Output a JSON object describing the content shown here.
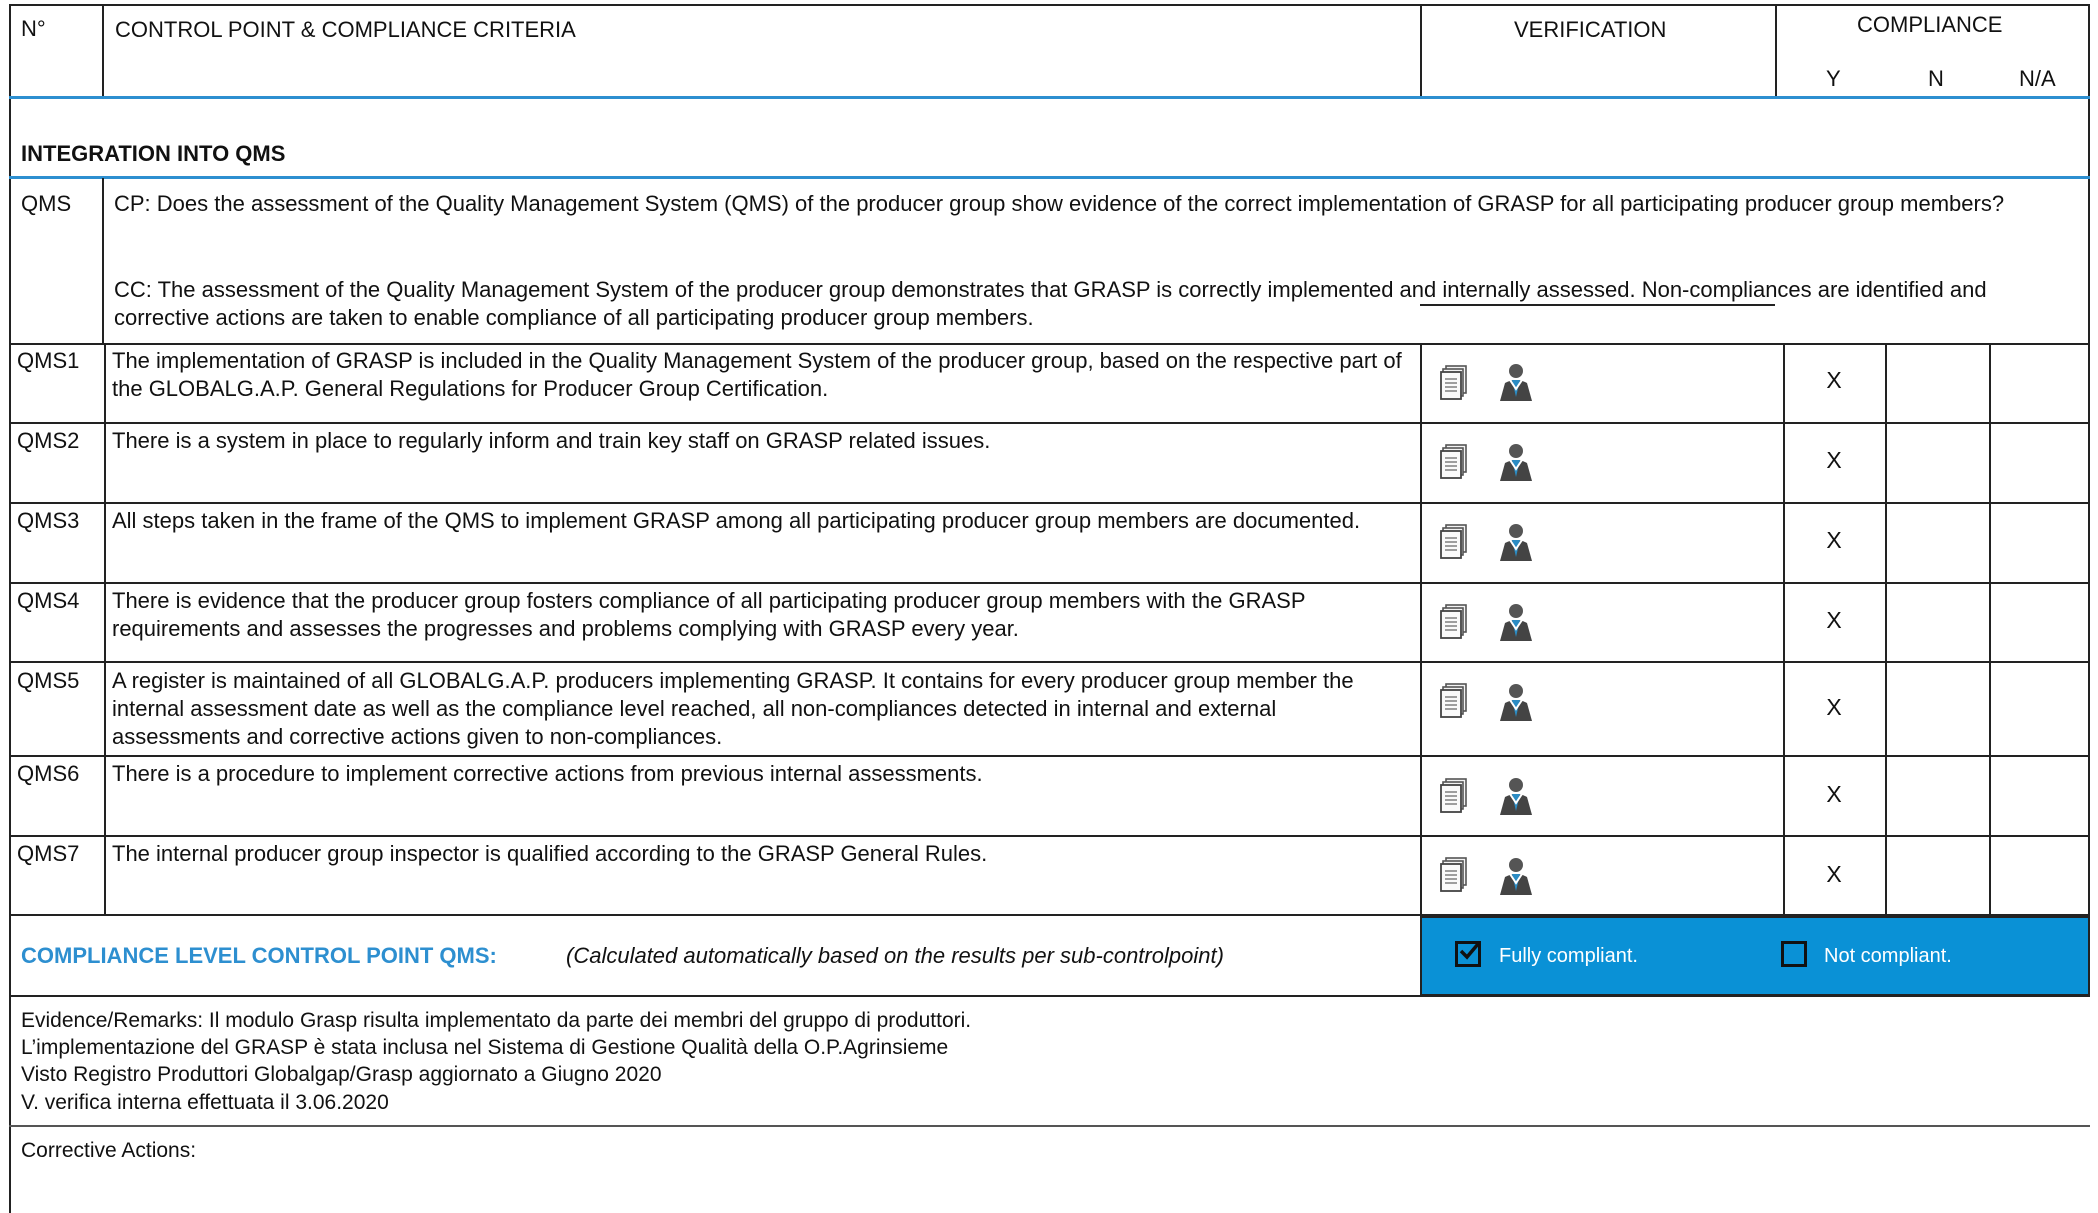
{
  "header": {
    "no_label": "N°",
    "cp_label": "CONTROL POINT & COMPLIANCE CRITERIA",
    "verification_label": "VERIFICATION",
    "compliance_label": "COMPLIANCE",
    "y_label": "Y",
    "n_label": "N",
    "na_label": "N/A"
  },
  "section": {
    "title": "INTEGRATION INTO QMS"
  },
  "qms": {
    "id": "QMS",
    "cp": "CP: Does the assessment of the Quality Management System (QMS) of the producer group show evidence of the correct implementation of GRASP for all participating producer group members?",
    "cc": "CC: The assessment of the Quality Management System of the producer group demonstrates that GRASP is correctly implemented and internally assessed. Non-compliances are identified and corrective actions are taken to enable compliance of all participating producer group members."
  },
  "rows": [
    {
      "id": "QMS1",
      "text": "The implementation of GRASP is included in the Quality Management System of the producer group, based on the respective part of the GLOBALG.A.P. General Regulations for Producer Group Certification.",
      "y": "X"
    },
    {
      "id": "QMS2",
      "text": "There is a system in place to regularly inform and train key staff on GRASP related issues.",
      "y": "X"
    },
    {
      "id": "QMS3",
      "text": "All steps taken in the frame of the QMS to implement GRASP among all participating producer group members are documented.",
      "y": "X"
    },
    {
      "id": "QMS4",
      "text": "There is evidence that the producer group fosters compliance of all participating producer group members with the GRASP requirements and assesses the progresses and problems complying with GRASP every year.",
      "y": "X"
    },
    {
      "id": "QMS5",
      "text": "A register is maintained of all GLOBALG.A.P. producers implementing GRASP. It contains for every producer group member the internal assessment date as well as the compliance level reached, all non-compliances detected in internal and external assessments and corrective actions given to non-compliances.",
      "y": "X"
    },
    {
      "id": "QMS6",
      "text": "There is a procedure to implement corrective actions from previous internal assessments.",
      "y": "X"
    },
    {
      "id": "QMS7",
      "text": "The internal producer group inspector is qualified according to the GRASP General Rules.",
      "y": "X"
    }
  ],
  "compliance_level": {
    "label": "COMPLIANCE LEVEL CONTROL POINT QMS:",
    "note": "(Calculated automatically based on the results per sub-controlpoint)",
    "fully_label": "Fully compliant.",
    "fully_checked": true,
    "not_label": "Not compliant.",
    "not_checked": false,
    "accent_color": "#0a91d6",
    "label_color": "#2d8fd0"
  },
  "evidence": {
    "line1": "Evidence/Remarks: Il modulo Grasp risulta implementato da parte dei membri del gruppo di produttori.",
    "line2": "L’implementazione del GRASP è stata inclusa nel Sistema di Gestione Qualità della O.P.Agrinsieme",
    "line3": "Visto Registro Produttori Globalgap/Grasp aggiornato a Giugno 2020",
    "line4": "V. verifica interna effettuata il 3.06.2020"
  },
  "corrective": {
    "label": "Corrective Actions:"
  },
  "icons": [
    "document-icon",
    "person-icon"
  ]
}
